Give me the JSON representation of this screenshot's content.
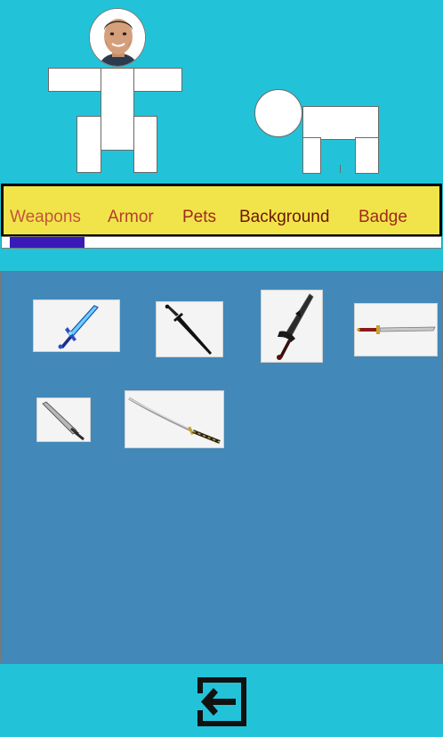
{
  "tabs": [
    {
      "label": "Weapons",
      "color": "#c4553a"
    },
    {
      "label": "Armor",
      "color": "#b2402e"
    },
    {
      "label": "Pets",
      "color": "#9e2a1e"
    },
    {
      "label": "Background",
      "color": "#6c1508"
    },
    {
      "label": "Badge",
      "color": "#9e2a1e"
    }
  ],
  "tab_scroll": {
    "visible_fraction": 0.17,
    "offset_fraction": 0.0,
    "color": "#3a1ab6"
  },
  "weapons": [
    {
      "name": "blue-crystal-sword"
    },
    {
      "name": "black-dagger"
    },
    {
      "name": "dark-ornate-sword"
    },
    {
      "name": "katana-red-hilt"
    },
    {
      "name": "short-sword"
    },
    {
      "name": "long-katana"
    }
  ],
  "icons": {
    "back": "exit-arrow-icon",
    "avatar": "face-photo",
    "pet": "pet-silhouette"
  },
  "colors": {
    "background": "#22c3d8",
    "tab_bar": "#f1e44a",
    "inventory_panel": "#4288b8"
  }
}
